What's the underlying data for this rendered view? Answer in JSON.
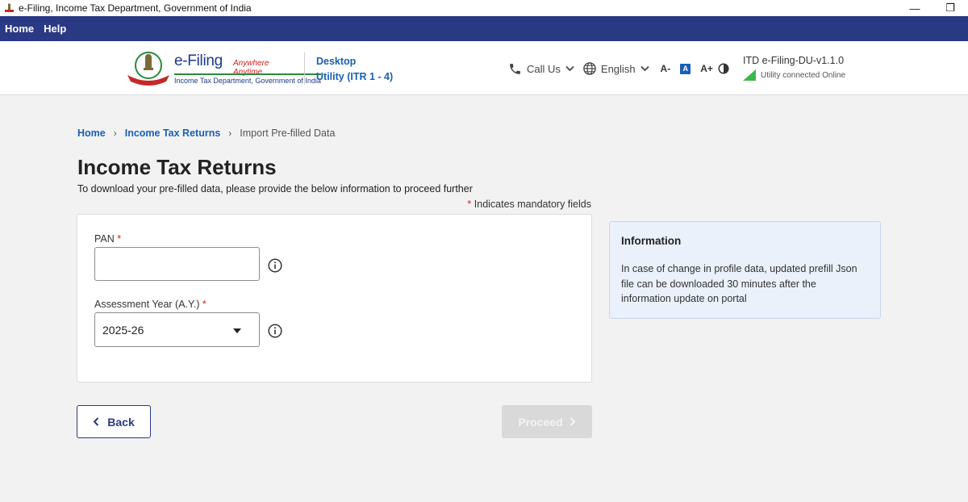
{
  "window": {
    "title": "e-Filing, Income Tax Department, Government of India",
    "minimize": "—",
    "restore": "❐"
  },
  "menu": {
    "items": [
      "Home",
      "Help"
    ]
  },
  "header": {
    "brand": "e-Filing",
    "tagline": "Anywhere Anytime",
    "dept": "Income Tax Department, Government of India",
    "product_line1": "Desktop",
    "product_line2": "Utility (ITR 1 - 4)",
    "call_us": "Call Us",
    "language": "English",
    "font_decrease": "A-",
    "font_normal": "A",
    "font_increase": "A+",
    "version": "ITD e-Filing-DU-v1.1.0",
    "status": "Utility connected Online"
  },
  "breadcrumb": {
    "home": "Home",
    "section": "Income Tax Returns",
    "current": "Import Pre-filled Data",
    "sep": "›"
  },
  "page": {
    "title": "Income Tax Returns",
    "subtitle": "To download your pre-filled data, please provide the below information to proceed further",
    "mandatory_star": "*",
    "mandatory_text": " Indicates mandatory fields"
  },
  "form": {
    "pan_label": "PAN",
    "pan_value": "",
    "pan_placeholder": "",
    "ay_label": "Assessment Year (A.Y.)",
    "ay_value": "2025-26",
    "required_star": " *"
  },
  "info": {
    "title": "Information",
    "text": "In case of change in profile data, updated prefill Json file can be downloaded 30 minutes after the information update on portal"
  },
  "buttons": {
    "back": "Back",
    "proceed": "Proceed"
  },
  "colors": {
    "menubar": "#2a3984",
    "link": "#1a5fb4",
    "required": "#d32020",
    "online": "#3cb84a"
  }
}
